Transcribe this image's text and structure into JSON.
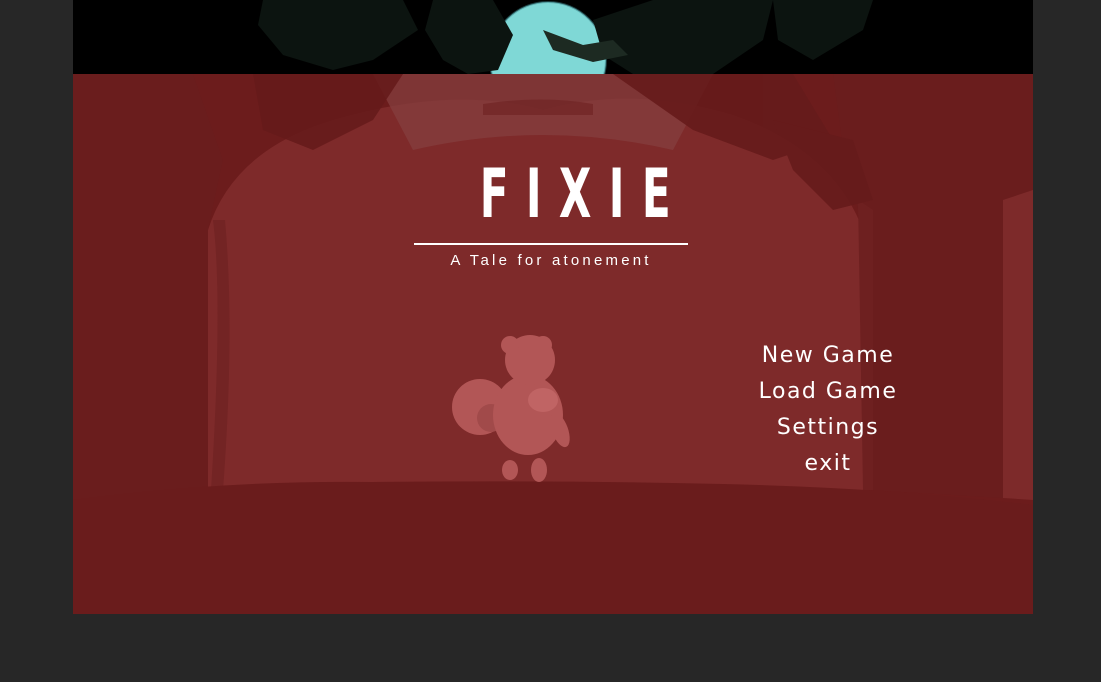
{
  "game": {
    "title": "FIXIE",
    "subtitle": "A Tale for atonement"
  },
  "menu": {
    "items": [
      {
        "label": "New Game"
      },
      {
        "label": "Load Game"
      },
      {
        "label": "Settings"
      },
      {
        "label": "exit"
      }
    ]
  },
  "colors": {
    "page_background": "#272727",
    "overlay_red": "#6c1c1c",
    "moon": "#7fd8d6",
    "text": "#ffffff"
  }
}
